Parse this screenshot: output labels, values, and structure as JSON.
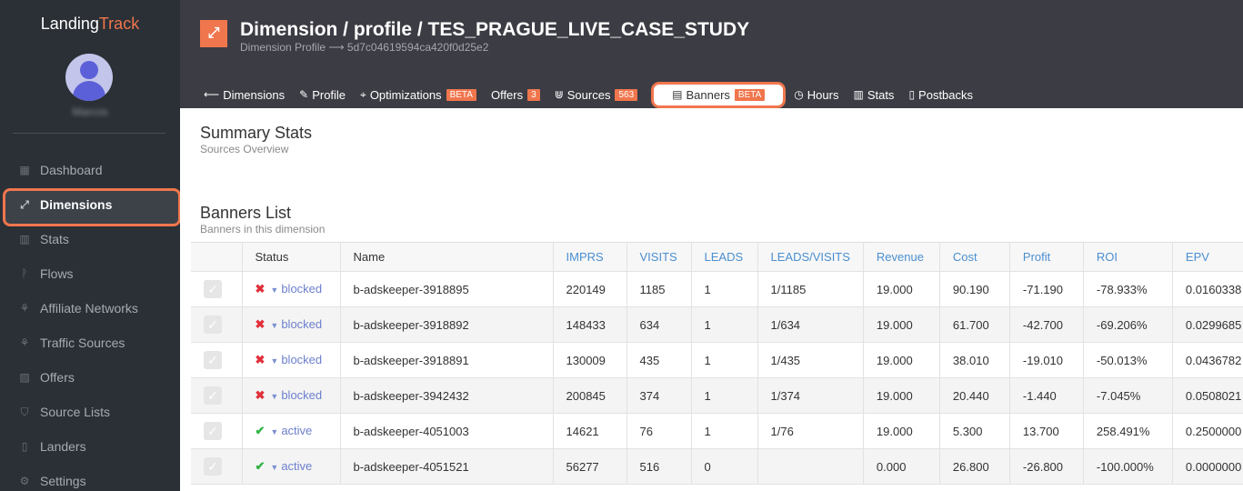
{
  "brand": {
    "part1": "Landing",
    "part2": "Track"
  },
  "user": {
    "name": "Marcos"
  },
  "sidebar": {
    "items": [
      {
        "label": "Dashboard",
        "icon": "▦"
      },
      {
        "label": "Dimensions",
        "icon": "⤢"
      },
      {
        "label": "Stats",
        "icon": "▥"
      },
      {
        "label": "Flows",
        "icon": "ᚹ"
      },
      {
        "label": "Affiliate Networks",
        "icon": "⚘"
      },
      {
        "label": "Traffic Sources",
        "icon": "⚘"
      },
      {
        "label": "Offers",
        "icon": "▨"
      },
      {
        "label": "Source Lists",
        "icon": "⛉"
      },
      {
        "label": "Landers",
        "icon": "▯"
      },
      {
        "label": "Settings",
        "icon": "⚙"
      }
    ]
  },
  "header": {
    "icon": "⤢",
    "title": "Dimension / profile / TES_PRAGUE_LIVE_CASE_STUDY",
    "subtitle": "Dimension Profile ⟶ 5d7c04619594ca420f0d25e2"
  },
  "tabs": [
    {
      "label": "Dimensions",
      "icon": "⟵"
    },
    {
      "label": "Profile",
      "icon": "✎"
    },
    {
      "label": "Optimizations",
      "icon": "⌖",
      "badge": "BETA"
    },
    {
      "label": "Offers",
      "badge": "3"
    },
    {
      "label": "Sources",
      "icon": "⋓",
      "badge": "563"
    },
    {
      "label": "Banners",
      "icon": "▤",
      "badge": "BETA"
    },
    {
      "label": "Hours",
      "icon": "◷"
    },
    {
      "label": "Stats",
      "icon": "▥"
    },
    {
      "label": "Postbacks",
      "icon": "▯"
    }
  ],
  "summary": {
    "title": "Summary Stats",
    "subtitle": "Sources Overview"
  },
  "banners": {
    "title": "Banners List",
    "subtitle": "Banners in this dimension"
  },
  "table": {
    "headers": [
      "Status",
      "Name",
      "IMPRS",
      "VISITS",
      "LEADS",
      "LEADS/VISITS",
      "Revenue",
      "Cost",
      "Profit",
      "ROI",
      "EPV"
    ],
    "rows": [
      {
        "status": "blocked",
        "name": "b-adskeeper-3918895",
        "imprs": "220149",
        "visits": "1185",
        "leads": "1",
        "lv": "1/1185",
        "revenue": "19.000",
        "cost": "90.190",
        "profit": "-71.190",
        "roi": "-78.933%",
        "epv": "0.0160338"
      },
      {
        "status": "blocked",
        "name": "b-adskeeper-3918892",
        "imprs": "148433",
        "visits": "634",
        "leads": "1",
        "lv": "1/634",
        "revenue": "19.000",
        "cost": "61.700",
        "profit": "-42.700",
        "roi": "-69.206%",
        "epv": "0.0299685"
      },
      {
        "status": "blocked",
        "name": "b-adskeeper-3918891",
        "imprs": "130009",
        "visits": "435",
        "leads": "1",
        "lv": "1/435",
        "revenue": "19.000",
        "cost": "38.010",
        "profit": "-19.010",
        "roi": "-50.013%",
        "epv": "0.0436782"
      },
      {
        "status": "blocked",
        "name": "b-adskeeper-3942432",
        "imprs": "200845",
        "visits": "374",
        "leads": "1",
        "lv": "1/374",
        "revenue": "19.000",
        "cost": "20.440",
        "profit": "-1.440",
        "roi": "-7.045%",
        "epv": "0.0508021"
      },
      {
        "status": "active",
        "name": "b-adskeeper-4051003",
        "imprs": "14621",
        "visits": "76",
        "leads": "1",
        "lv": "1/76",
        "revenue": "19.000",
        "cost": "5.300",
        "profit": "13.700",
        "roi": "258.491%",
        "epv": "0.2500000"
      },
      {
        "status": "active",
        "name": "b-adskeeper-4051521",
        "imprs": "56277",
        "visits": "516",
        "leads": "0",
        "lv": "",
        "revenue": "0.000",
        "cost": "26.800",
        "profit": "-26.800",
        "roi": "-100.000%",
        "epv": "0.0000000"
      }
    ]
  },
  "colors": {
    "accent": "#f0764d",
    "sidebar": "#2b3036",
    "header": "#3c3c44",
    "link": "#4a8fd0"
  }
}
